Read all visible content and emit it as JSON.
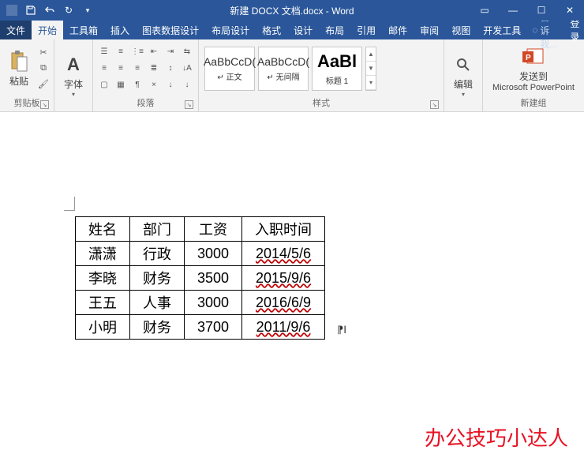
{
  "window": {
    "title": "新建 DOCX 文档.docx - Word",
    "qat": {
      "save": "save",
      "undo": "undo",
      "redo": "redo",
      "more": "▾"
    },
    "controls": {
      "ribbon_opts": "▭",
      "min": "—",
      "max": "☐",
      "close": "✕"
    }
  },
  "tabs": {
    "file": "文件",
    "home": "开始",
    "toolbox": "工具箱",
    "insert": "插入",
    "chartdata": "图表数据设计",
    "layout": "布局设计",
    "format": "格式",
    "design": "设计",
    "layout2": "布局",
    "references": "引用",
    "mailings": "邮件",
    "review": "审阅",
    "view": "视图",
    "developer": "开发工具",
    "tellme": "告诉我...",
    "login": "登录"
  },
  "ribbon": {
    "clipboard": {
      "paste": "粘贴",
      "label": "剪贴板"
    },
    "font": {
      "button": "字体",
      "label": ""
    },
    "paragraph": {
      "label": "段落"
    },
    "styles": {
      "label": "样式",
      "items": [
        {
          "preview": "AaBbCcD(",
          "name": "↵ 正文"
        },
        {
          "preview": "AaBbCcD(",
          "name": "↵ 无间隔"
        },
        {
          "preview": "AaBl",
          "name": "标题 1"
        }
      ]
    },
    "editing": {
      "button": "编辑",
      "label": ""
    },
    "newgroup": {
      "sendto": "发送到",
      "target": "Microsoft PowerPoint",
      "label": "新建组"
    }
  },
  "table": {
    "headers": [
      "姓名",
      "部门",
      "工资",
      "入职时间"
    ],
    "rows": [
      [
        "潇潇",
        "行政",
        "3000",
        "2014/5/6"
      ],
      [
        "李晓",
        "财务",
        "3500",
        "2015/9/6"
      ],
      [
        "王五",
        "人事",
        "3000",
        "2016/6/9"
      ],
      [
        "小明",
        "财务",
        "3700",
        "2011/9/6"
      ]
    ]
  },
  "watermark": "办公技巧小达人"
}
